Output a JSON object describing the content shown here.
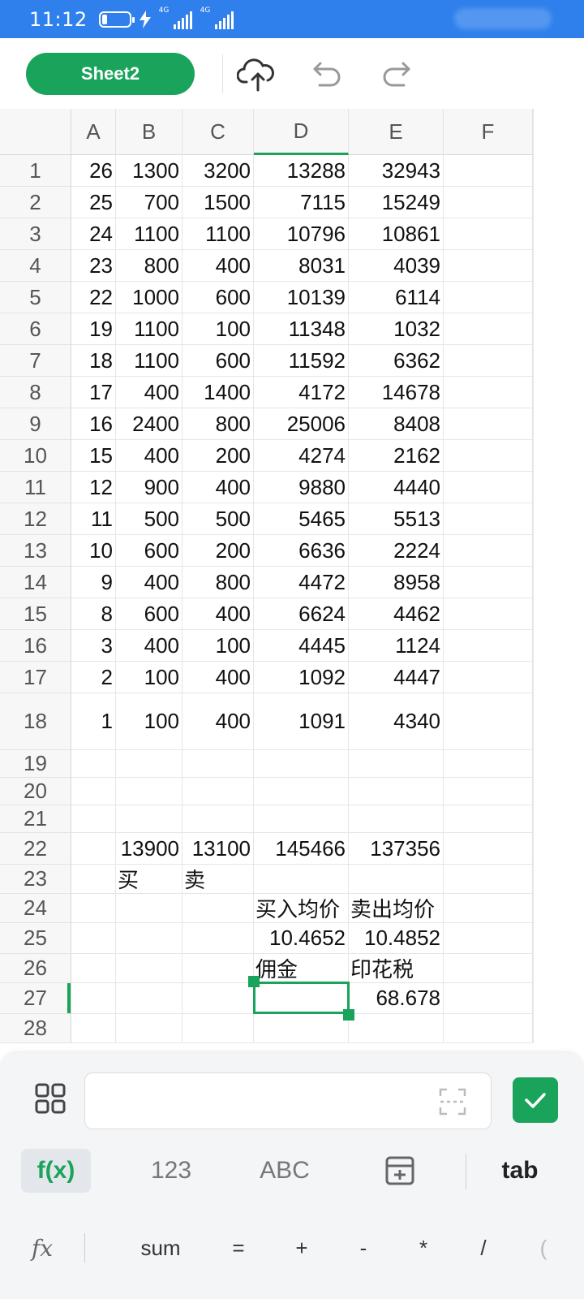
{
  "status_bar": {
    "time": "11:12",
    "network_1": "4G",
    "network_2": "4G"
  },
  "toolbar": {
    "sheet_label": "Sheet2",
    "icons": [
      "cloud-upload-icon",
      "undo-icon",
      "redo-icon"
    ]
  },
  "columns": [
    "A",
    "B",
    "C",
    "D",
    "E",
    "F"
  ],
  "active_column": "D",
  "active_row": 27,
  "rows": [
    {
      "num": "1",
      "cells": [
        "26",
        "1300",
        "3200",
        "13288",
        "32943",
        ""
      ]
    },
    {
      "num": "2",
      "cells": [
        "25",
        "700",
        "1500",
        "7115",
        "15249",
        ""
      ]
    },
    {
      "num": "3",
      "cells": [
        "24",
        "1100",
        "1100",
        "10796",
        "10861",
        ""
      ]
    },
    {
      "num": "4",
      "cells": [
        "23",
        "800",
        "400",
        "8031",
        "4039",
        ""
      ]
    },
    {
      "num": "5",
      "cells": [
        "22",
        "1000",
        "600",
        "10139",
        "6114",
        ""
      ]
    },
    {
      "num": "6",
      "cells": [
        "19",
        "1100",
        "100",
        "11348",
        "1032",
        ""
      ]
    },
    {
      "num": "7",
      "cells": [
        "18",
        "1100",
        "600",
        "11592",
        "6362",
        ""
      ]
    },
    {
      "num": "8",
      "cells": [
        "17",
        "400",
        "1400",
        "4172",
        "14678",
        ""
      ]
    },
    {
      "num": "9",
      "cells": [
        "16",
        "2400",
        "800",
        "25006",
        "8408",
        ""
      ]
    },
    {
      "num": "10",
      "cells": [
        "15",
        "400",
        "200",
        "4274",
        "2162",
        ""
      ]
    },
    {
      "num": "11",
      "cells": [
        "12",
        "900",
        "400",
        "9880",
        "4440",
        ""
      ]
    },
    {
      "num": "12",
      "cells": [
        "11",
        "500",
        "500",
        "5465",
        "5513",
        ""
      ]
    },
    {
      "num": "13",
      "cells": [
        "10",
        "600",
        "200",
        "6636",
        "2224",
        ""
      ]
    },
    {
      "num": "14",
      "cells": [
        "9",
        "400",
        "800",
        "4472",
        "8958",
        ""
      ]
    },
    {
      "num": "15",
      "cells": [
        "8",
        "600",
        "400",
        "6624",
        "4462",
        ""
      ]
    },
    {
      "num": "16",
      "cells": [
        "3",
        "400",
        "100",
        "4445",
        "1124",
        ""
      ]
    },
    {
      "num": "17",
      "cells": [
        "2",
        "100",
        "400",
        "1092",
        "4447",
        ""
      ]
    },
    {
      "num": "18",
      "cells": [
        "1",
        "100",
        "400",
        "1091",
        "4340",
        ""
      ]
    },
    {
      "num": "19",
      "cells": [
        "",
        "",
        "",
        "",
        "",
        ""
      ]
    },
    {
      "num": "20",
      "cells": [
        "",
        "",
        "",
        "",
        "",
        ""
      ]
    },
    {
      "num": "21",
      "cells": [
        "",
        "",
        "",
        "",
        "",
        ""
      ]
    },
    {
      "num": "22",
      "cells": [
        "",
        "13900",
        "13100",
        "145466",
        "137356",
        ""
      ]
    },
    {
      "num": "23",
      "cells": [
        "",
        "买",
        "卖",
        "",
        "",
        ""
      ]
    },
    {
      "num": "24",
      "cells": [
        "",
        "",
        "",
        "买入均价",
        "卖出均价",
        ""
      ]
    },
    {
      "num": "25",
      "cells": [
        "",
        "",
        "",
        "10.4652",
        "10.4852",
        ""
      ]
    },
    {
      "num": "26",
      "cells": [
        "",
        "",
        "",
        "佣金",
        "印花税",
        ""
      ]
    },
    {
      "num": "27",
      "cells": [
        "",
        "",
        "",
        "",
        "68.678",
        ""
      ]
    },
    {
      "num": "28",
      "cells": [
        "",
        "",
        "",
        "",
        "",
        ""
      ]
    }
  ],
  "text_cells": [
    "23:1",
    "23:2",
    "24:3",
    "24:4",
    "26:3",
    "26:4"
  ],
  "formula_bar": {
    "value": "",
    "placeholder": ""
  },
  "keyboard_tabs": [
    {
      "label": "f(x)",
      "active": true
    },
    {
      "label": "123",
      "active": false
    },
    {
      "label": "ABC",
      "active": false
    },
    {
      "label": "calculator-icon",
      "active": false
    },
    {
      "label": "tab",
      "active": false
    }
  ],
  "operators": [
    "fx",
    "sum",
    "=",
    "+",
    "-",
    "*",
    "/",
    "("
  ],
  "colors": {
    "status_bar": "#2f80ed",
    "accent": "#1aa35a"
  }
}
